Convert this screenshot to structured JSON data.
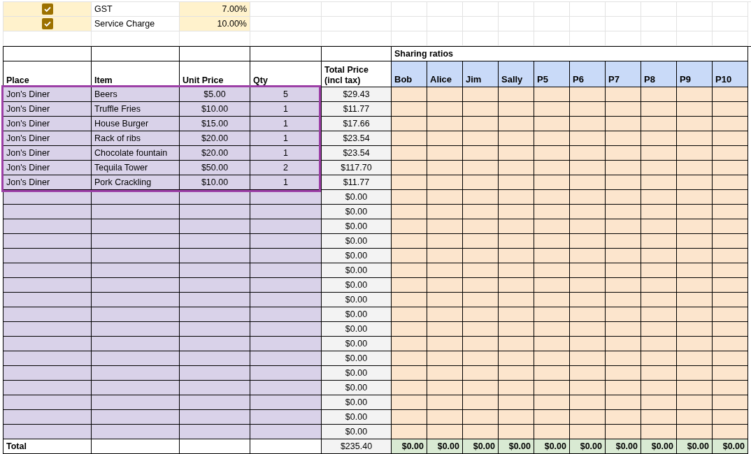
{
  "settings": [
    {
      "checked": true,
      "label": "GST",
      "value": "7.00%"
    },
    {
      "checked": true,
      "label": "Service Charge",
      "value": "10.00%"
    }
  ],
  "table": {
    "group_heading": "Sharing ratios",
    "columns": [
      "Place",
      "Item",
      "Unit Price",
      "Qty",
      "Total Price\n(incl tax)"
    ],
    "people": [
      "Bob",
      "Alice",
      "Jim",
      "Sally",
      "P5",
      "P6",
      "P7",
      "P8",
      "P9",
      "P10"
    ],
    "rows": [
      {
        "place": "Jon's Diner",
        "item": "Beers",
        "unit_price": "$5.00",
        "qty": "5",
        "total": "$29.43"
      },
      {
        "place": "Jon's Diner",
        "item": "Truffle Fries",
        "unit_price": "$10.00",
        "qty": "1",
        "total": "$11.77"
      },
      {
        "place": "Jon's Diner",
        "item": "House Burger",
        "unit_price": "$15.00",
        "qty": "1",
        "total": "$17.66"
      },
      {
        "place": "Jon's Diner",
        "item": "Rack of ribs",
        "unit_price": "$20.00",
        "qty": "1",
        "total": "$23.54"
      },
      {
        "place": "Jon's Diner",
        "item": "Chocolate fountain",
        "unit_price": "$20.00",
        "qty": "1",
        "total": "$23.54"
      },
      {
        "place": "Jon's Diner",
        "item": "Tequila Tower",
        "unit_price": "$50.00",
        "qty": "2",
        "total": "$117.70"
      },
      {
        "place": "Jon's Diner",
        "item": "Pork Crackling",
        "unit_price": "$10.00",
        "qty": "1",
        "total": "$11.77"
      },
      {
        "total": "$0.00"
      },
      {
        "total": "$0.00"
      },
      {
        "total": "$0.00"
      },
      {
        "total": "$0.00"
      },
      {
        "total": "$0.00"
      },
      {
        "total": "$0.00"
      },
      {
        "total": "$0.00"
      },
      {
        "total": "$0.00"
      },
      {
        "total": "$0.00"
      },
      {
        "total": "$0.00"
      },
      {
        "total": "$0.00"
      },
      {
        "total": "$0.00"
      },
      {
        "total": "$0.00"
      },
      {
        "total": "$0.00"
      },
      {
        "total": "$0.00"
      },
      {
        "total": "$0.00"
      },
      {
        "total": "$0.00"
      }
    ],
    "totals_row": {
      "label": "Total",
      "total": "$235.40",
      "shares": [
        "$0.00",
        "$0.00",
        "$0.00",
        "$0.00",
        "$0.00",
        "$0.00",
        "$0.00",
        "$0.00",
        "$0.00",
        "$0.00"
      ]
    }
  }
}
